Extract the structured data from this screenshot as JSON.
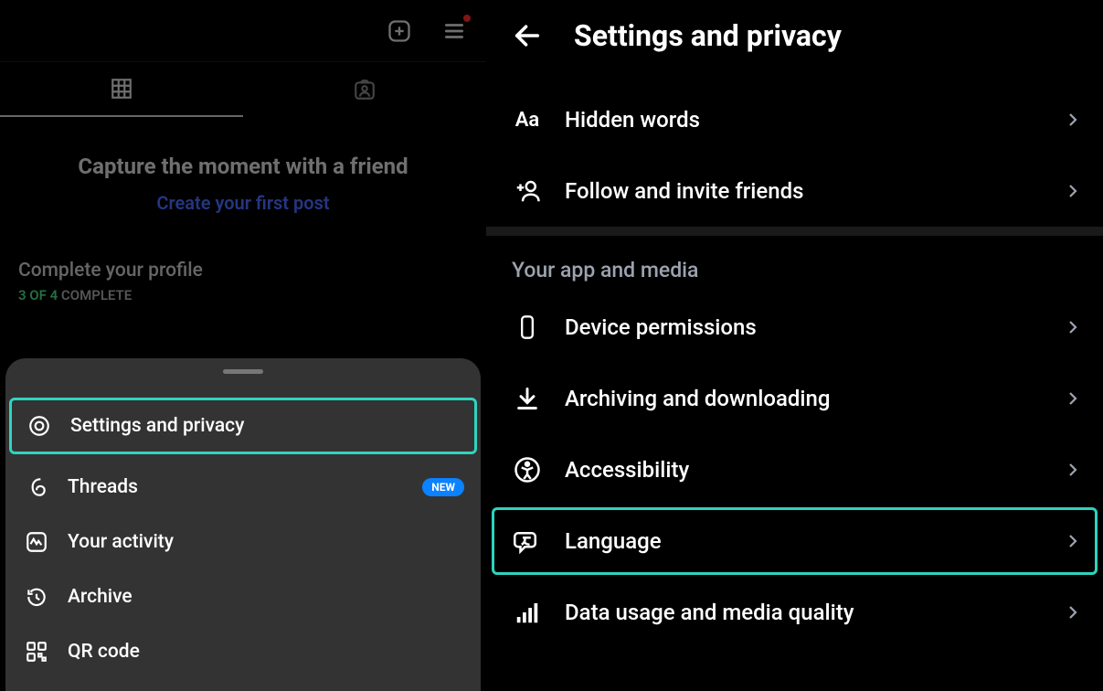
{
  "left": {
    "moment_title": "Capture the moment with a friend",
    "create_link": "Create your first post",
    "complete_title": "Complete your profile",
    "complete_progress_done": "3 OF 4",
    "complete_progress_label": " COMPLETE",
    "menu": [
      {
        "label": "Settings and privacy"
      },
      {
        "label": "Threads",
        "badge": "NEW"
      },
      {
        "label": "Your activity"
      },
      {
        "label": "Archive"
      },
      {
        "label": "QR code"
      }
    ]
  },
  "right": {
    "title": "Settings and privacy",
    "top_rows": [
      {
        "label": "Hidden words"
      },
      {
        "label": "Follow and invite friends"
      }
    ],
    "section_label": "Your app and media",
    "section_rows": [
      {
        "label": "Device permissions"
      },
      {
        "label": "Archiving and downloading"
      },
      {
        "label": "Accessibility"
      },
      {
        "label": "Language"
      },
      {
        "label": "Data usage and media quality"
      }
    ]
  }
}
